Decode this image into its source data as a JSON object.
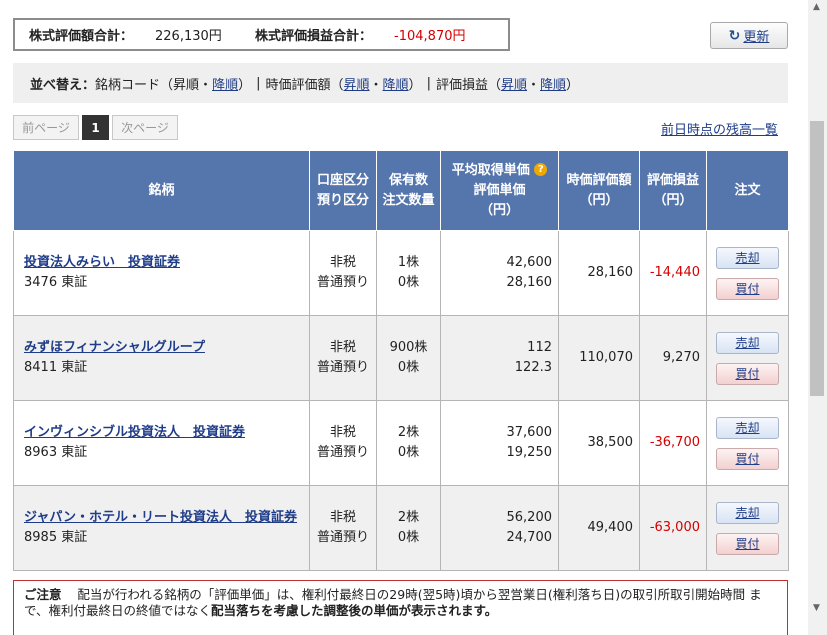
{
  "summary": {
    "valuation_label": "株式評価額合計：",
    "valuation_value": "226,130円",
    "pl_label": "株式評価損益合計：",
    "pl_value": "-104,870円"
  },
  "refresh": {
    "label": "更新",
    "icon": "refresh-icon"
  },
  "sort": {
    "title": "並べ替え：",
    "code_label": "銘柄コード（",
    "asc": "昇順",
    "dot": "・",
    "desc": "降順",
    "close": "）",
    "sep": "|",
    "price_label": "時価評価額（",
    "pl_label": "評価損益（"
  },
  "pager": {
    "prev": "前ページ",
    "current": "1",
    "next": "次ページ"
  },
  "prev_day_link": "前日時点の残高一覧",
  "table": {
    "headers": {
      "name": "銘柄",
      "account_1": "口座区分",
      "account_2": "預り区分",
      "qty_1": "保有数",
      "qty_2": "注文数量",
      "avg_1": "平均取得単価",
      "avg_2": "評価単価",
      "avg_3": "（円）",
      "market_1": "時価評価額",
      "market_2": "（円）",
      "pl_1": "評価損益",
      "pl_2": "（円）",
      "order": "注文"
    },
    "rows": [
      {
        "name": "投資法人みらい　投資証券",
        "code": "3476 東証",
        "acct1": "非税",
        "acct2": "普通預り",
        "qty1": "1株",
        "qty2": "0株",
        "avg": "42,600",
        "eval": "28,160",
        "market": "28,160",
        "pl": "-14,440"
      },
      {
        "name": "みずほフィナンシャルグループ",
        "code": "8411 東証",
        "acct1": "非税",
        "acct2": "普通預り",
        "qty1": "900株",
        "qty2": "0株",
        "avg": "112",
        "eval": "122.3",
        "market": "110,070",
        "pl": "9,270"
      },
      {
        "name": "インヴィンシブル投資法人　投資証券",
        "code": "8963 東証",
        "acct1": "非税",
        "acct2": "普通預り",
        "qty1": "2株",
        "qty2": "0株",
        "avg": "37,600",
        "eval": "19,250",
        "market": "38,500",
        "pl": "-36,700"
      },
      {
        "name": "ジャパン・ホテル・リート投資法人　投資証券",
        "code": "8985 東証",
        "acct1": "非税",
        "acct2": "普通預り",
        "qty1": "2株",
        "qty2": "0株",
        "avg": "56,200",
        "eval": "24,700",
        "market": "49,400",
        "pl": "-63,000"
      }
    ],
    "sell_label": "売却",
    "buy_label": "買付"
  },
  "notice": {
    "title": "ご注意",
    "text1": "配当が行われる銘柄の「評価単価」は、権利付最終日の29時(翌5時)頃から翌営業日(権利落ち日)の取引所取引開始時間",
    "text2": "まで、権利付最終日の終値ではなく",
    "text_bold": "配当落ちを考慮した調整後の単価が表示されます。"
  },
  "colors": {
    "header_bg": "#5575ad",
    "negative": "#d40000",
    "link": "#1f3c88"
  }
}
